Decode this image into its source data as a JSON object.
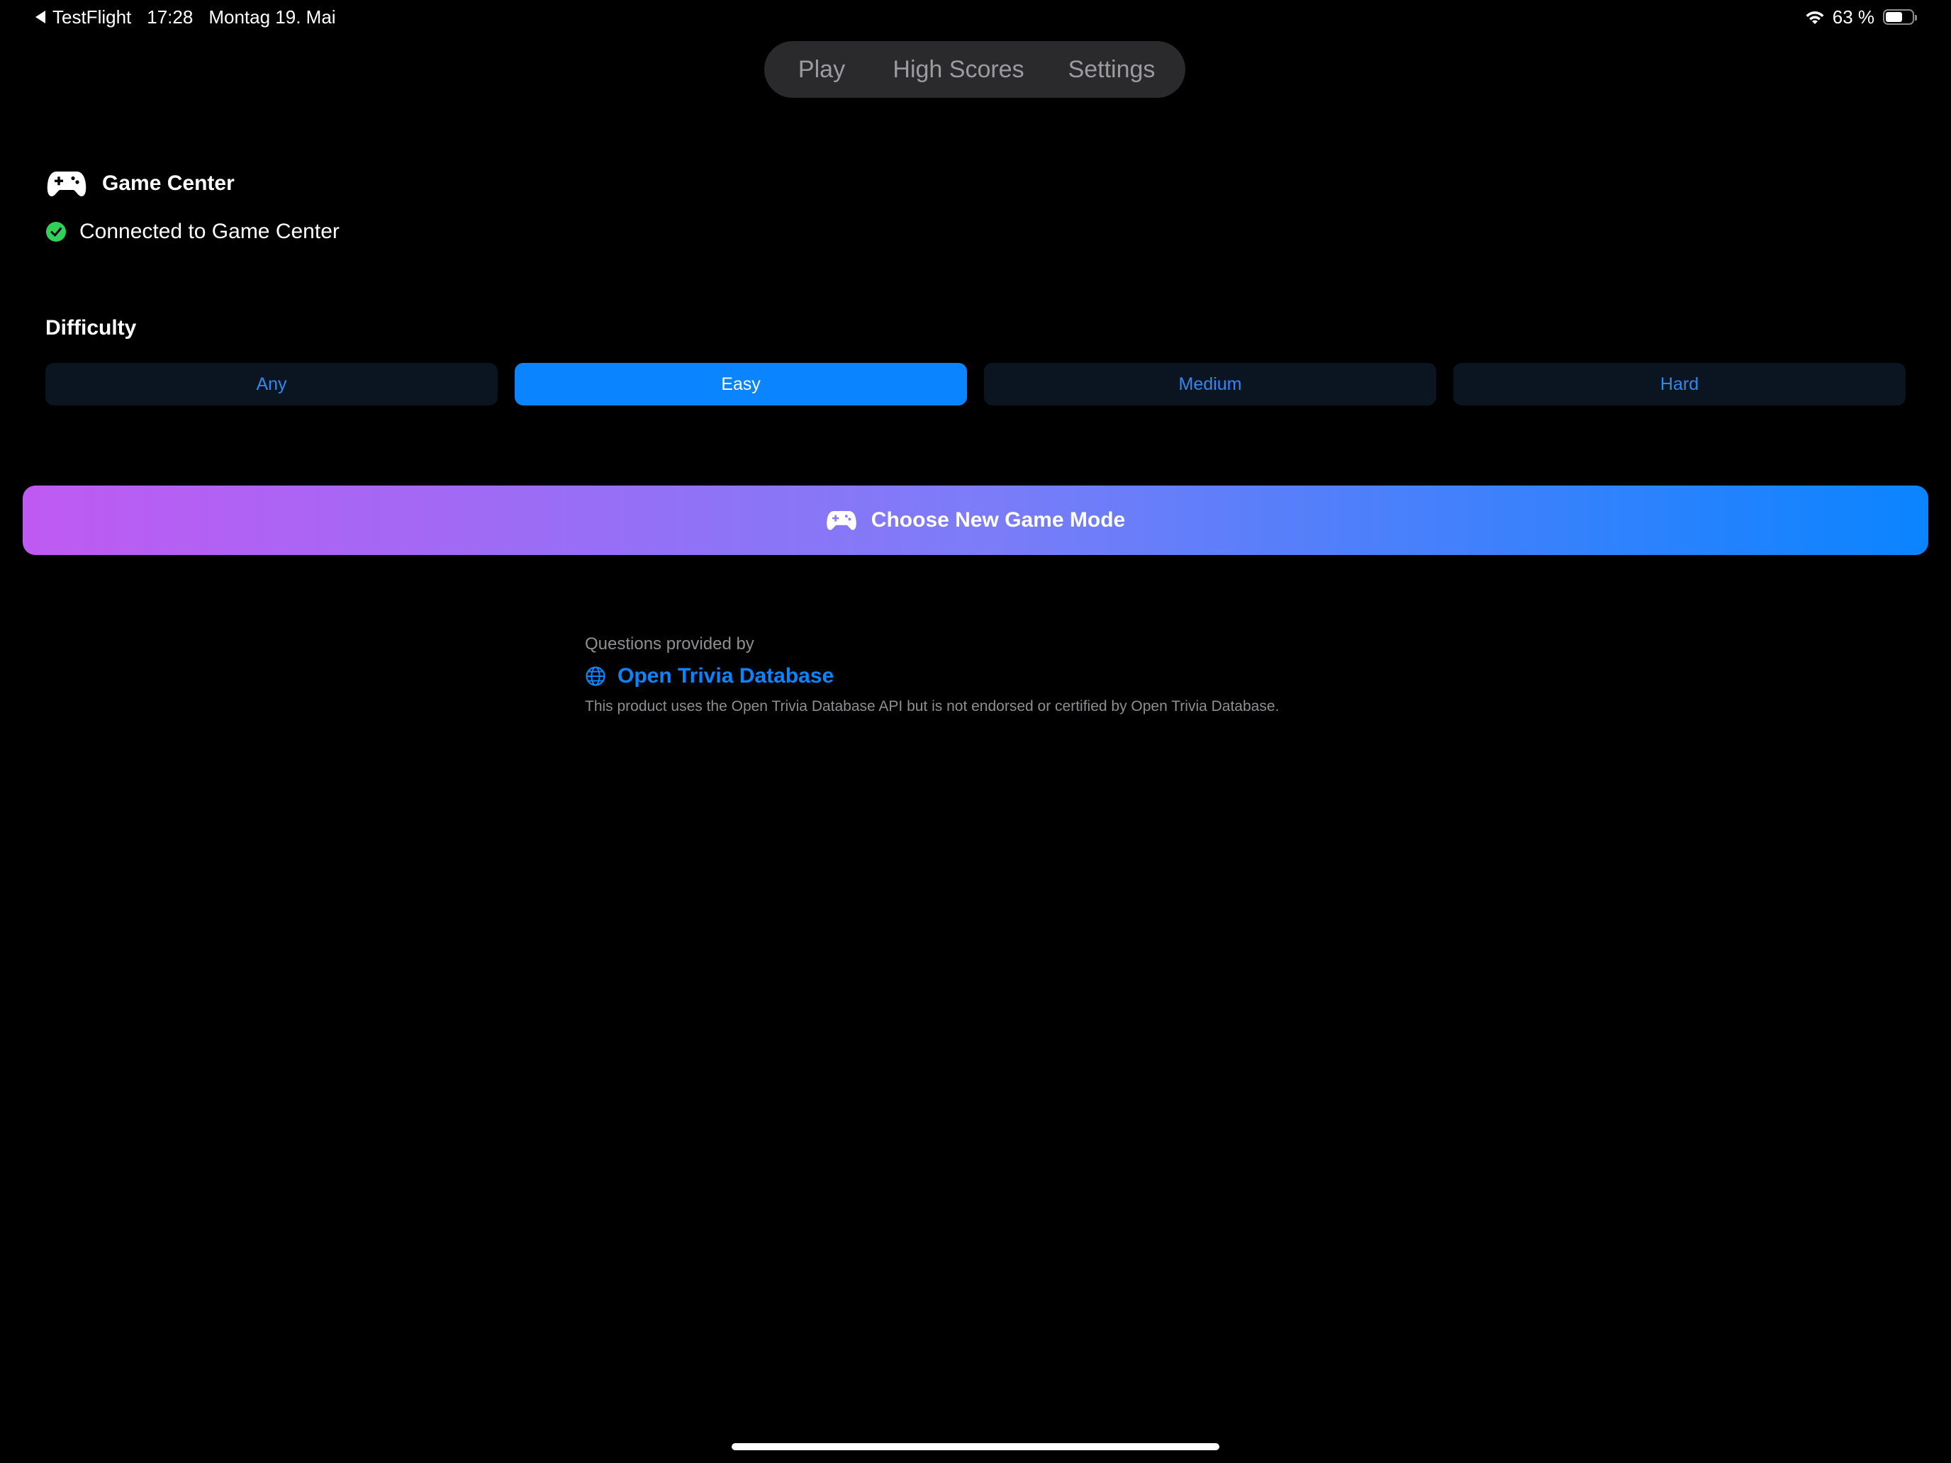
{
  "status_bar": {
    "back_app": "TestFlight",
    "time": "17:28",
    "date": "Montag 19. Mai",
    "battery_text": "63 %",
    "battery_level": 0.63
  },
  "tabs": [
    {
      "label": "Play",
      "active": false
    },
    {
      "label": "High Scores",
      "active": false
    },
    {
      "label": "Settings",
      "active": true
    }
  ],
  "game_center": {
    "title": "Game Center",
    "status": "Connected to Game Center",
    "status_color": "#30d158"
  },
  "difficulty": {
    "label": "Difficulty",
    "options": [
      "Any",
      "Easy",
      "Medium",
      "Hard"
    ],
    "selected": "Easy"
  },
  "new_game_button": {
    "label": "Choose New Game Mode",
    "gradient_start": "#bf5af2",
    "gradient_end": "#0a84ff"
  },
  "credits": {
    "caption": "Questions provided by",
    "link_text": "Open Trivia Database",
    "disclaimer": "This product uses the Open Trivia Database API but is not endorsed or certified by Open Trivia Database."
  },
  "icons": {
    "back": "back-arrow-icon",
    "wifi": "wifi-icon",
    "battery": "battery-icon",
    "game_center": "game-controller-icon",
    "connected": "checkmark-circle-icon",
    "new_game": "game-controller-icon",
    "link": "globe-icon"
  },
  "colors": {
    "background": "#000000",
    "accent": "#0a84ff",
    "tab_bar": "#2a2a2c",
    "tab_active": "#48484b",
    "difficulty_unselected": "#0b1521"
  }
}
